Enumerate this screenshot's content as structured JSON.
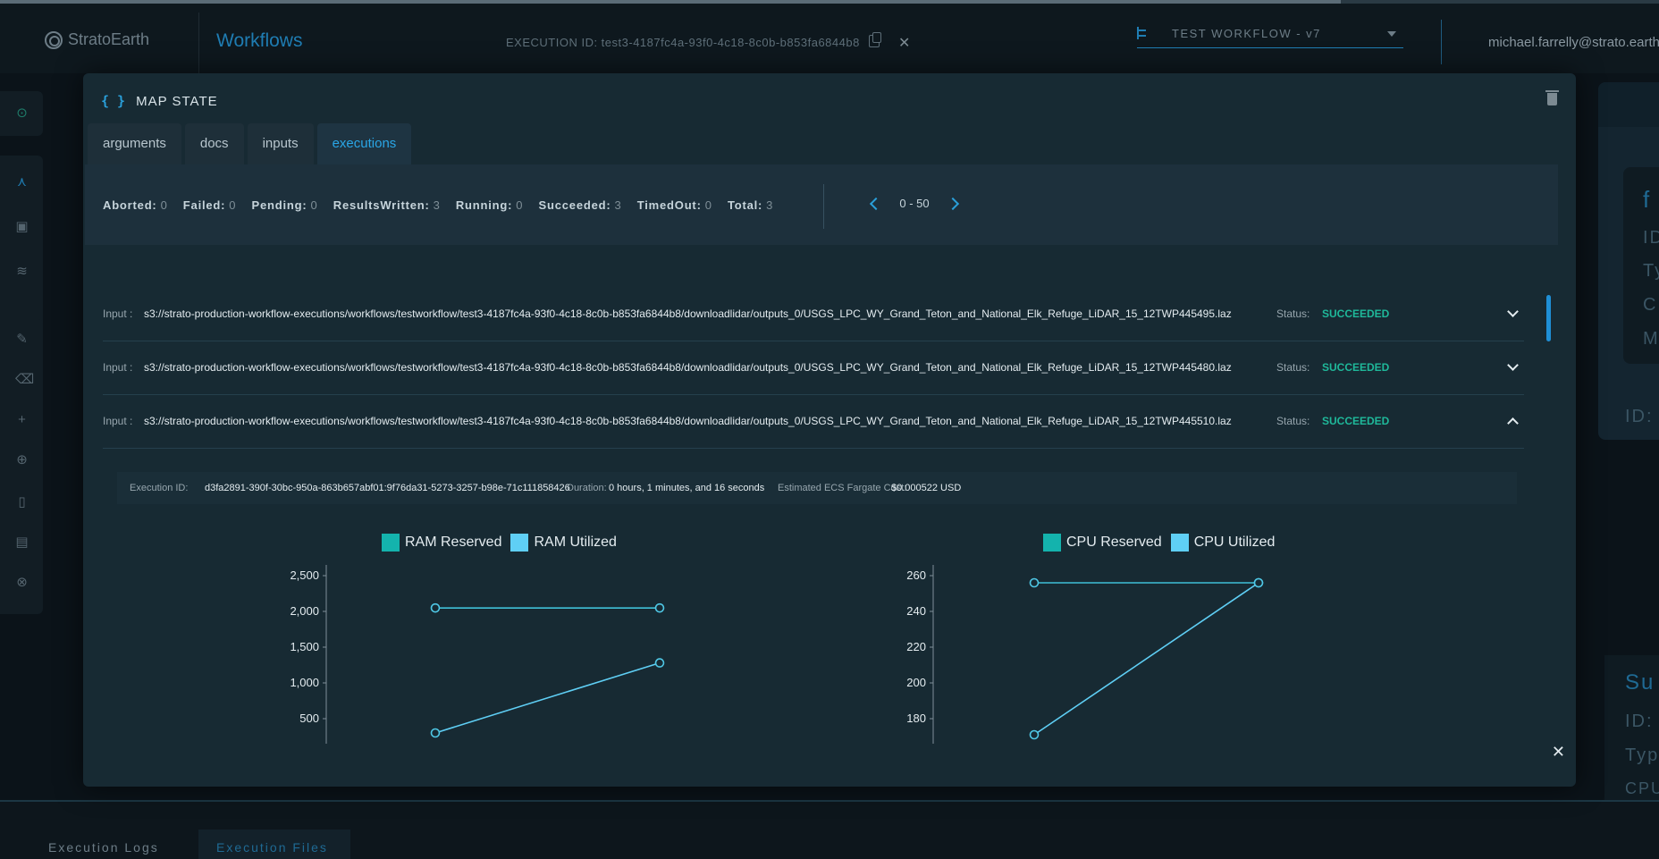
{
  "header": {
    "brand": "StratoEarth",
    "app_title": "Workflows",
    "execution_id_label": "EXECUTION ID: test3-4187fc4a-93f0-4c18-8c0b-b853fa6844b8",
    "workflow_select": "TEST WORKFLOW - v7",
    "user_email": "michael.farrelly@strato.earth"
  },
  "background": {
    "bottom_tabs": [
      "Execution Logs",
      "Execution Files"
    ],
    "right_panel_fragments": [
      "f",
      "ID",
      "Ty",
      "C",
      "M",
      "ID:",
      "Su",
      "ID:",
      "Typ",
      "CPU"
    ]
  },
  "modal": {
    "title": "MAP STATE",
    "tabs": [
      {
        "label": "arguments",
        "active": false
      },
      {
        "label": "docs",
        "active": false
      },
      {
        "label": "inputs",
        "active": false
      },
      {
        "label": "executions",
        "active": true
      }
    ],
    "stats": [
      {
        "key": "Aborted:",
        "value": "0"
      },
      {
        "key": "Failed:",
        "value": "0"
      },
      {
        "key": "Pending:",
        "value": "0"
      },
      {
        "key": "ResultsWritten:",
        "value": "3"
      },
      {
        "key": "Running:",
        "value": "0"
      },
      {
        "key": "Succeeded:",
        "value": "3"
      },
      {
        "key": "TimedOut:",
        "value": "0"
      },
      {
        "key": "Total:",
        "value": "3"
      }
    ],
    "pager_range": "0 - 50",
    "rows": [
      {
        "input_label": "Input :",
        "path": "s3://strato-production-workflow-executions/workflows/testworkflow/test3-4187fc4a-93f0-4c18-8c0b-b853fa6844b8/downloadlidar/outputs_0/USGS_LPC_WY_Grand_Teton_and_National_Elk_Refuge_LiDAR_15_12TWP445495.laz",
        "status_label": "Status:",
        "status": "SUCCEEDED",
        "expanded": false
      },
      {
        "input_label": "Input :",
        "path": "s3://strato-production-workflow-executions/workflows/testworkflow/test3-4187fc4a-93f0-4c18-8c0b-b853fa6844b8/downloadlidar/outputs_0/USGS_LPC_WY_Grand_Teton_and_National_Elk_Refuge_LiDAR_15_12TWP445480.laz",
        "status_label": "Status:",
        "status": "SUCCEEDED",
        "expanded": false
      },
      {
        "input_label": "Input :",
        "path": "s3://strato-production-workflow-executions/workflows/testworkflow/test3-4187fc4a-93f0-4c18-8c0b-b853fa6844b8/downloadlidar/outputs_0/USGS_LPC_WY_Grand_Teton_and_National_Elk_Refuge_LiDAR_15_12TWP445510.laz",
        "status_label": "Status:",
        "status": "SUCCEEDED",
        "expanded": true
      }
    ],
    "detail": {
      "execution_id_label": "Execution ID:",
      "execution_id": "d3fa2891-390f-30bc-950a-863b657abf01:9f76da31-5273-3257-b98e-71c111858426",
      "duration_label": "Duration:",
      "duration": "0 hours, 1 minutes, and 16 seconds",
      "cost_label": "Estimated ECS Fargate Cost:",
      "cost": "$0.000522 USD"
    }
  },
  "colors": {
    "accent": "#2a9fd9",
    "success": "#1fb89a",
    "reserved": "#14b3ad",
    "utilized": "#5fcff5"
  },
  "chart_data": [
    {
      "type": "line",
      "legend": [
        "RAM Reserved",
        "RAM Utilized"
      ],
      "yticks": [
        "2,500",
        "2,000",
        "1,500",
        "1,000",
        "500"
      ],
      "ylim": [
        0,
        2500
      ],
      "x": [
        0,
        1
      ],
      "series": [
        {
          "name": "RAM Reserved",
          "values": [
            2048,
            2048
          ]
        },
        {
          "name": "RAM Utilized",
          "values": [
            300,
            1280
          ]
        }
      ]
    },
    {
      "type": "line",
      "legend": [
        "CPU Reserved",
        "CPU Utilized"
      ],
      "yticks": [
        "260",
        "240",
        "220",
        "200",
        "180"
      ],
      "ylim": [
        160,
        260
      ],
      "x": [
        0,
        1
      ],
      "series": [
        {
          "name": "CPU Reserved",
          "values": [
            256,
            256
          ]
        },
        {
          "name": "CPU Utilized",
          "values": [
            171,
            256
          ]
        }
      ]
    }
  ]
}
